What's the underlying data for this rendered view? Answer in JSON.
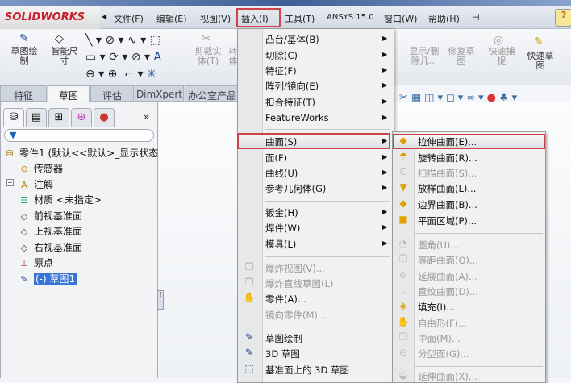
{
  "app": {
    "logo": "SOLIDWORKS"
  },
  "menubar": [
    {
      "label": "文件(F)"
    },
    {
      "label": "编辑(E)"
    },
    {
      "label": "视图(V)"
    },
    {
      "label": "插入(I)"
    },
    {
      "label": "工具(T)"
    },
    {
      "label": "ANSYS 15.0"
    },
    {
      "label": "窗口(W)"
    },
    {
      "label": "帮助(H)"
    }
  ],
  "toolbar": {
    "sketch": "草图绘\n制",
    "smart_dim": "智能尺\n寸",
    "trim": "剪裁实\n体(T)",
    "convert": "转\n体",
    "show_delete": "显示/删\n除几...",
    "repair": "修复草\n图",
    "quick_snap": "快速捕\n捉",
    "rapid_sketch": "快速草\n图"
  },
  "tabs": [
    "特征",
    "草图",
    "评估",
    "DimXpert",
    "办公室产品"
  ],
  "tree": {
    "root": "零件1 (默认<<默认>_显示状态",
    "items": [
      "传感器",
      "注解",
      "材质 <未指定>",
      "前视基准面",
      "上视基准面",
      "右视基准面",
      "原点",
      "(-) 草图1"
    ]
  },
  "insert_menu": [
    {
      "label": "凸台/基体(B)",
      "sub": true
    },
    {
      "label": "切除(C)",
      "sub": true
    },
    {
      "label": "特征(F)",
      "sub": true
    },
    {
      "label": "阵列/镜向(E)",
      "sub": true
    },
    {
      "label": "扣合特征(T)",
      "sub": true
    },
    {
      "label": "FeatureWorks",
      "sub": true
    },
    {
      "label": "曲面(S)",
      "sub": true,
      "active": true
    },
    {
      "label": "面(F)",
      "sub": true
    },
    {
      "label": "曲线(U)",
      "sub": true
    },
    {
      "label": "参考几何体(G)",
      "sub": true
    },
    {
      "label": "钣金(H)",
      "sub": true
    },
    {
      "label": "焊件(W)",
      "sub": true
    },
    {
      "label": "模具(L)",
      "sub": true
    },
    {
      "label": "爆炸视图(V)...",
      "disabled": true
    },
    {
      "label": "爆炸直线草图(L)",
      "disabled": true
    },
    {
      "label": "零件(A)..."
    },
    {
      "label": "镜向零件(M)...",
      "disabled": true
    },
    {
      "label": "草图绘制"
    },
    {
      "label": "3D 草图"
    },
    {
      "label": "基准面上的 3D 草图"
    }
  ],
  "surface_menu": [
    {
      "label": "拉伸曲面(E)...",
      "active": true
    },
    {
      "label": "旋转曲面(R)..."
    },
    {
      "label": "扫描曲面(S)...",
      "disabled": true
    },
    {
      "label": "放样曲面(L)..."
    },
    {
      "label": "边界曲面(B)..."
    },
    {
      "label": "平面区域(P)..."
    },
    {
      "label": "圆角(U)...",
      "disabled": true
    },
    {
      "label": "等距曲面(O)...",
      "disabled": true
    },
    {
      "label": "延展曲面(A)...",
      "disabled": true
    },
    {
      "label": "直纹曲面(D)...",
      "disabled": true
    },
    {
      "label": "填充(I)..."
    },
    {
      "label": "自由形(F)...",
      "disabled": true
    },
    {
      "label": "中面(M)...",
      "disabled": true
    },
    {
      "label": "分型面(G)...",
      "disabled": true
    },
    {
      "label": "延伸曲面(X)...",
      "disabled": true
    }
  ],
  "colors": {
    "highlight": "#c9434b",
    "logo": "#c8202a"
  }
}
